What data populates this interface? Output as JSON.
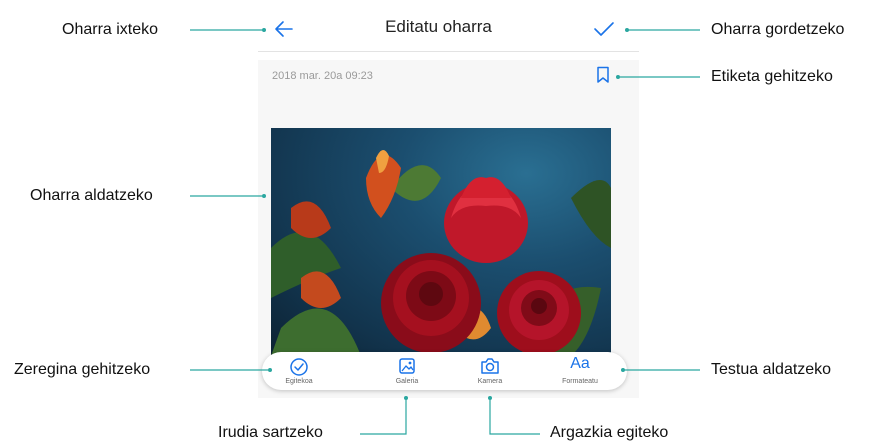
{
  "header": {
    "title": "Editatu oharra",
    "back_icon": "arrow-left-icon",
    "save_icon": "checkmark-icon"
  },
  "note": {
    "date": "2018 mar. 20a 09:23",
    "tag_icon": "bookmark-icon"
  },
  "toolbar": {
    "items": [
      {
        "label": "Egitekoa",
        "icon": "check-circle-icon"
      },
      {
        "label": "Galeria",
        "icon": "image-icon"
      },
      {
        "label": "Kamera",
        "icon": "camera-icon"
      },
      {
        "label": "Formateatu",
        "icon": "text-format-icon",
        "glyph": "Aa"
      }
    ]
  },
  "callouts": {
    "exit": "Oharra ixteko",
    "save": "Oharra gordetzeko",
    "tag": "Etiketa gehitzeko",
    "edit": "Oharra aldatzeko",
    "task": "Zeregina gehitzeko",
    "text": "Testua aldatzeko",
    "image": "Irudia sartzeko",
    "photo": "Argazkia egiteko"
  },
  "colors": {
    "accent": "#1a73e8",
    "callout_line": "#2aa7a0"
  }
}
